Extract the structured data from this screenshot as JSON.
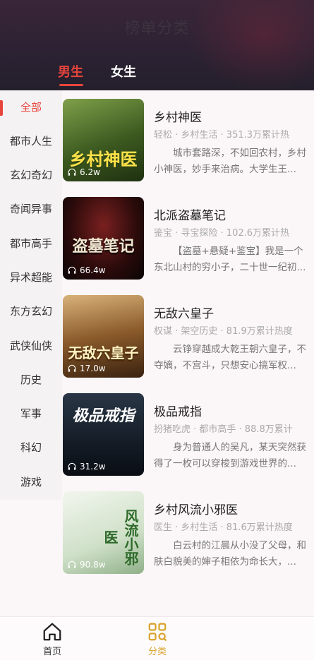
{
  "header": {
    "title": "榜单分类",
    "tabs": [
      {
        "label": "男生",
        "active": true
      },
      {
        "label": "女生",
        "active": false
      }
    ]
  },
  "sidebar": {
    "items": [
      {
        "label": "全部",
        "active": true
      },
      {
        "label": "都市人生"
      },
      {
        "label": "玄幻奇幻"
      },
      {
        "label": "奇闻异事"
      },
      {
        "label": "都市高手"
      },
      {
        "label": "异术超能"
      },
      {
        "label": "东方玄幻"
      },
      {
        "label": "武侠仙侠"
      },
      {
        "label": "历史"
      },
      {
        "label": "军事"
      },
      {
        "label": "科幻"
      },
      {
        "label": "游戏"
      }
    ]
  },
  "books": [
    {
      "title": "乡村神医",
      "meta": "轻松 · 乡村生活 · 351.3万累计热",
      "desc": "城市套路深，不如回农村，乡村小神医，妙手来治病。大学生王...",
      "listens": "6.2w",
      "cover_text": "乡村神医",
      "cover_colors": [
        "#6f8a3a",
        "#2e4a1a"
      ]
    },
    {
      "title": "北派盗墓笔记",
      "meta": "鉴宝 · 寻宝探险 · 102.6万累计热",
      "desc": "【盗墓+悬疑+鉴宝】我是一个东北山村的穷小子，二十世一纪初...",
      "listens": "66.4w",
      "cover_text": "盗墓笔记",
      "cover_colors": [
        "#5a1a1a",
        "#120808"
      ]
    },
    {
      "title": "无敌六皇子",
      "meta": "权谋 · 架空历史 · 81.9万累计热度",
      "desc": "云铮穿越成大乾王朝六皇子，不夺嫡，不宫斗，只想安心搞军权...",
      "listens": "17.0w",
      "cover_text": "无敌六皇子",
      "cover_colors": [
        "#b88a4a",
        "#5a3a1a"
      ]
    },
    {
      "title": "极品戒指",
      "meta": "扮猪吃虎 · 都市高手 · 88.8万累计",
      "desc": "身为普通人的吴凡，某天突然获得了一枚可以穿梭到游戏世界的...",
      "listens": "31.2w",
      "cover_text": "极品戒指",
      "cover_colors": [
        "#3a4a5a",
        "#0e141c"
      ]
    },
    {
      "title": "乡村风流小邪医",
      "meta": "医生 · 乡村生活 · 81.6万累计热度",
      "desc": "白云村的江晨从小没了父母，和肤白貌美的婶子相依为命长大，...",
      "listens": "90.8w",
      "cover_text": "风流小邪医",
      "cover_colors": [
        "#e8efe6",
        "#9fb89a"
      ]
    }
  ],
  "bottom_nav": [
    {
      "label": "首页",
      "icon": "home-icon",
      "active": false
    },
    {
      "label": "分类",
      "icon": "category-icon",
      "active": true
    }
  ],
  "colors": {
    "accent": "#e8453c",
    "nav_active": "#d9a32c"
  }
}
